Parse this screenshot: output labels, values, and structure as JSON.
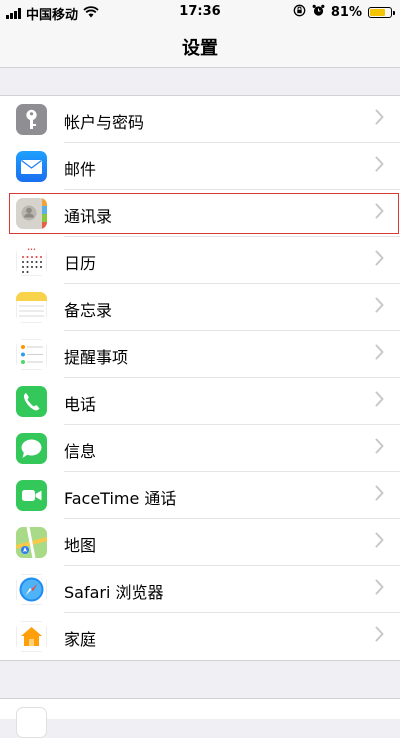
{
  "status_bar": {
    "carrier": "中国移动",
    "time": "17:36",
    "battery_text": "81%",
    "battery_level": 0.81,
    "icons": [
      "signal-icon",
      "wifi-icon",
      "orientation-lock-icon",
      "alarm-icon",
      "battery-icon"
    ]
  },
  "nav": {
    "title": "设置"
  },
  "settings": {
    "items": [
      {
        "label": "帐户与密码",
        "icon": "key-icon",
        "color": "#8e8e93"
      },
      {
        "label": "邮件",
        "icon": "mail-icon",
        "color": "#1a8cff"
      },
      {
        "label": "通讯录",
        "icon": "contacts-icon",
        "color": "#c9c6c0",
        "highlighted": true
      },
      {
        "label": "日历",
        "icon": "calendar-icon",
        "color": "#ffffff"
      },
      {
        "label": "备忘录",
        "icon": "notes-icon",
        "color": "#ffffff"
      },
      {
        "label": "提醒事项",
        "icon": "reminders-icon",
        "color": "#ffffff"
      },
      {
        "label": "电话",
        "icon": "phone-icon",
        "color": "#34c759"
      },
      {
        "label": "信息",
        "icon": "messages-icon",
        "color": "#34c759"
      },
      {
        "label": "FaceTime 通话",
        "icon": "facetime-icon",
        "color": "#34c759"
      },
      {
        "label": "地图",
        "icon": "maps-icon",
        "color": "#6cc24a"
      },
      {
        "label": "Safari 浏览器",
        "icon": "safari-icon",
        "color": "#ffffff"
      },
      {
        "label": "家庭",
        "icon": "home-icon",
        "color": "#ffffff"
      }
    ]
  },
  "colors": {
    "highlight": "#d83b32",
    "chevron": "#c7c7cc",
    "background": "#efeff4"
  }
}
